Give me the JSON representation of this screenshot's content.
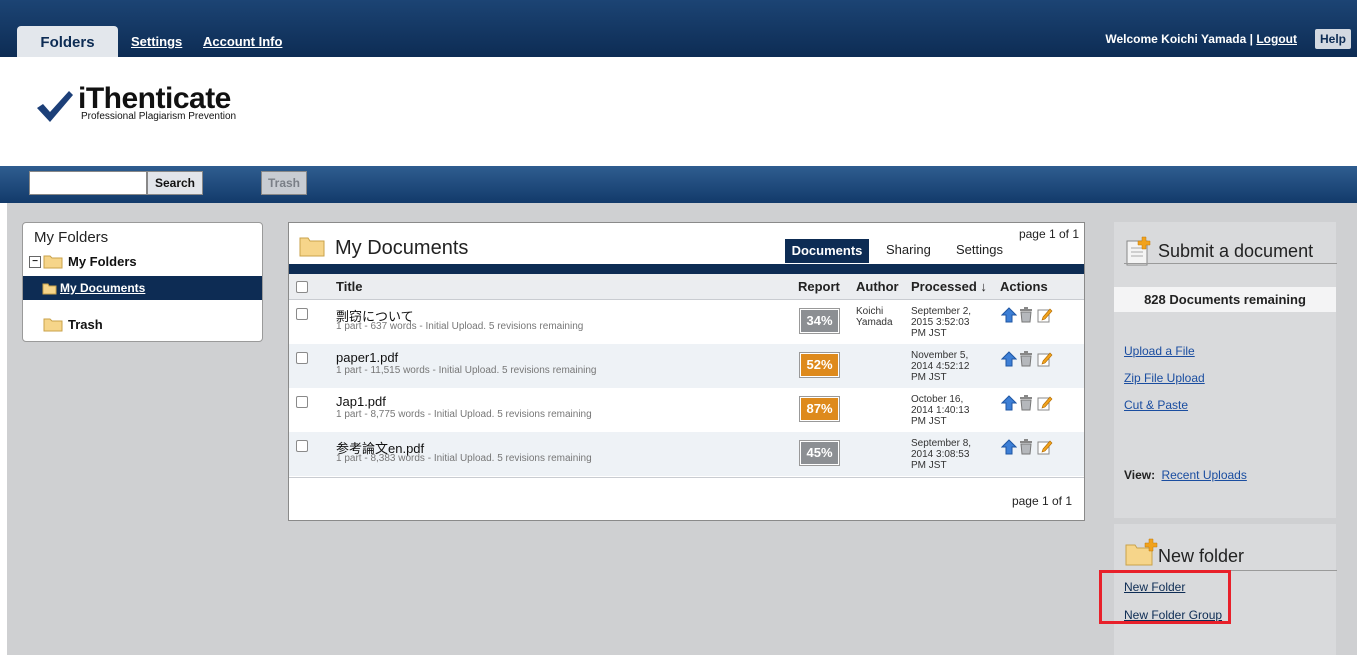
{
  "topnav": {
    "tabs": [
      {
        "label": "Folders",
        "active": true
      },
      {
        "label": "Settings"
      },
      {
        "label": "Account Info"
      }
    ],
    "welcome_text": "Welcome Koichi Yamada |",
    "logout_label": "Logout",
    "help_label": "Help"
  },
  "logo": {
    "name": "iThenticate",
    "tagline": "Professional Plagiarism Prevention"
  },
  "searchbar": {
    "search_value": "",
    "search_label": "Search",
    "trash_label": "Trash"
  },
  "sidebar": {
    "title": "My Folders",
    "tree": [
      {
        "label": "My Folders",
        "expanded": true,
        "icon": "folder-icon"
      },
      {
        "label": "My Documents",
        "selected": true,
        "icon": "folder-open-icon"
      },
      {
        "label": "Trash",
        "icon": "folder-icon"
      }
    ]
  },
  "documents": {
    "title": "My Documents",
    "page_label_top": "page 1 of 1",
    "page_label_bottom": "page 1 of 1",
    "tabs": [
      {
        "label": "Documents",
        "active": true
      },
      {
        "label": "Sharing"
      },
      {
        "label": "Settings"
      }
    ],
    "columns": [
      "Title",
      "Report",
      "Author",
      "Processed ↓",
      "Actions"
    ],
    "rows": [
      {
        "title": "剽窃について",
        "meta": "1 part - 637 words - Initial Upload. 5 revisions remaining",
        "report": "34%",
        "report_color": "#8c8f93",
        "author": "Koichi\nYamada",
        "processed": "September 2,\n2015 3:52:03\nPM JST"
      },
      {
        "title": "paper1.pdf",
        "meta": "1 part - 11,515 words - Initial Upload. 5 revisions remaining",
        "report": "52%",
        "report_color": "#de8a1c",
        "author": "",
        "processed": "November 5,\n2014 4:52:12\nPM JST"
      },
      {
        "title": "Jap1.pdf",
        "meta": "1 part - 8,775 words - Initial Upload. 5 revisions remaining",
        "report": "87%",
        "report_color": "#de8a1c",
        "author": "",
        "processed": "October 16,\n2014 1:40:13\nPM JST"
      },
      {
        "title": "参考論文en.pdf",
        "meta": "1 part - 8,383 words - Initial Upload. 5 revisions remaining",
        "report": "45%",
        "report_color": "#8c8f93",
        "author": "",
        "processed": "September 8,\n2014 3:08:53\nPM JST"
      }
    ],
    "action_icons": [
      "upload-icon",
      "trash-icon",
      "edit-icon"
    ]
  },
  "submit_panel": {
    "title": "Submit a document",
    "remaining": "828 Documents remaining",
    "links": [
      "Upload a File",
      "Zip File Upload",
      "Cut & Paste"
    ],
    "view_label": "View:",
    "view_link": "Recent Uploads"
  },
  "folder_panel": {
    "title": "New folder",
    "links": [
      "New Folder",
      "New Folder Group"
    ]
  },
  "colors": {
    "navy": "#0d2c54",
    "orange": "#de8a1c",
    "gray_badge": "#8c8f93",
    "highlight_red": "#e8202a"
  }
}
